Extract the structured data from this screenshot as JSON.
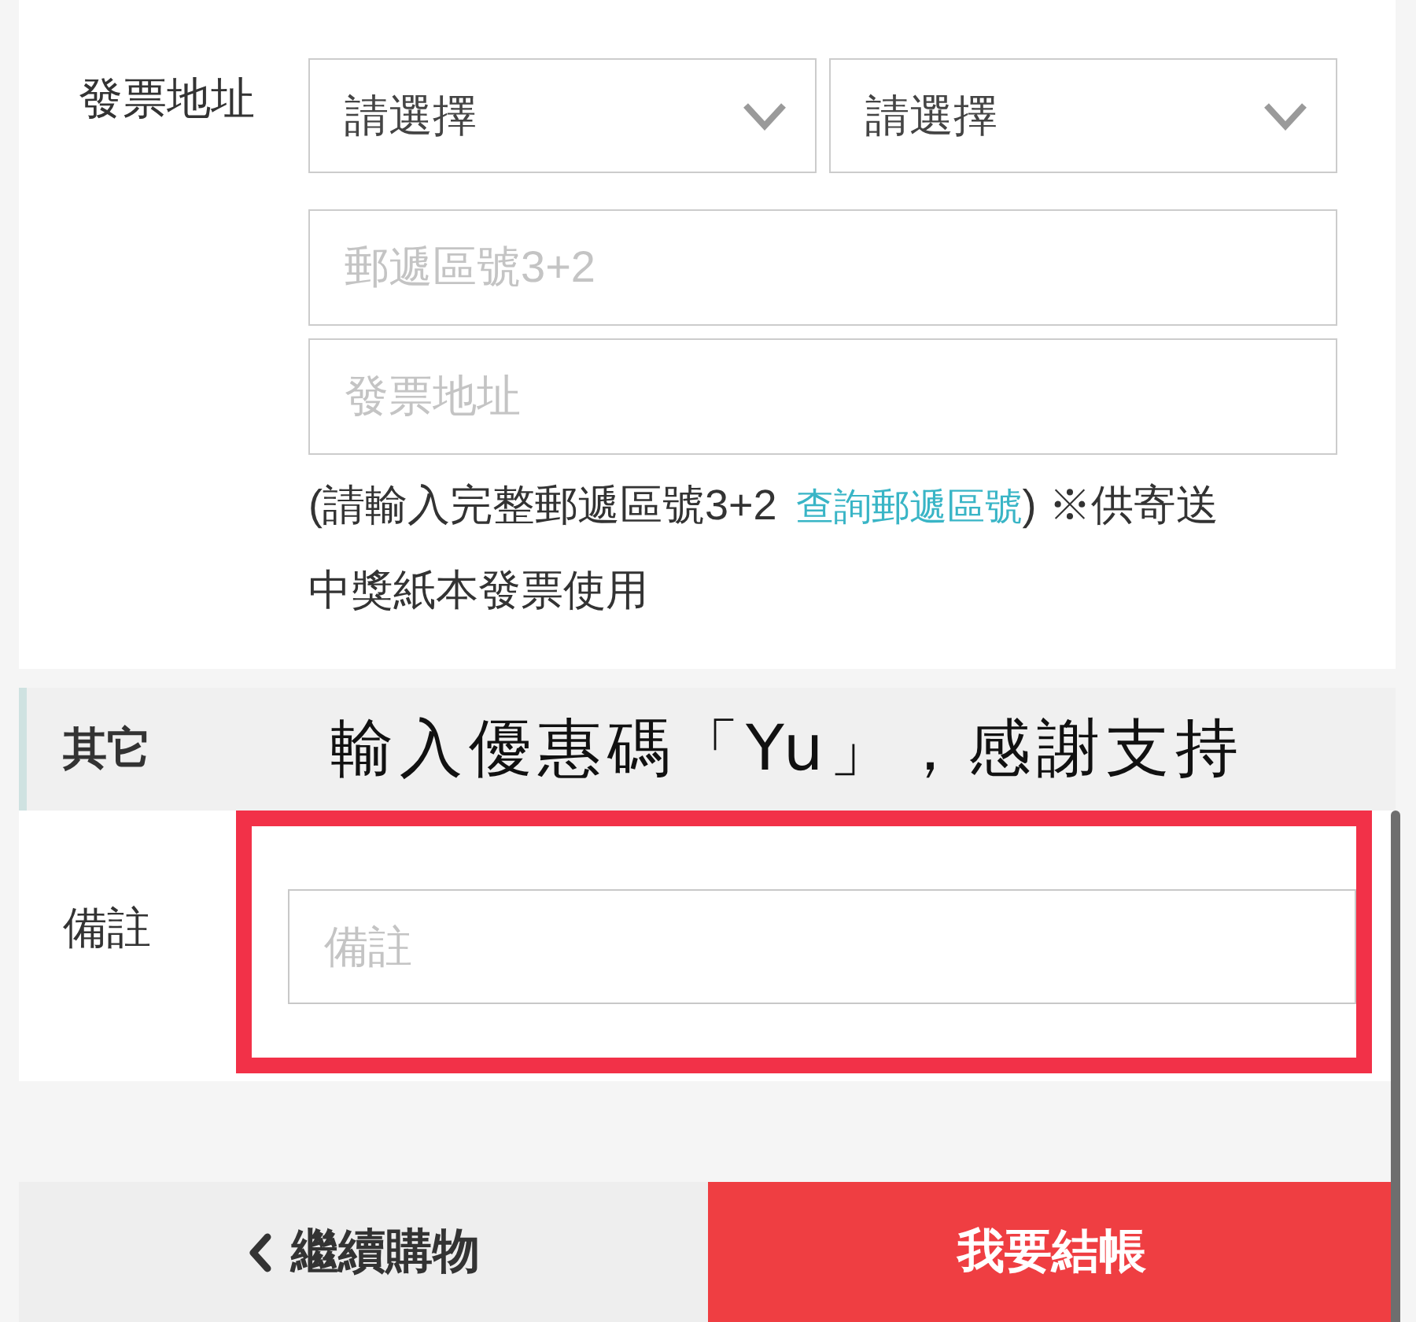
{
  "invoice_address": {
    "label": "發票地址",
    "selects": [
      {
        "value": "請選擇"
      },
      {
        "value": "請選擇"
      }
    ],
    "fields": [
      {
        "placeholder": "郵遞區號3+2"
      },
      {
        "placeholder": "發票地址"
      }
    ],
    "hint": {
      "text_before": "(請輸入完整郵遞區號3+2",
      "link": "查詢郵遞區號",
      "text_after": ") ※供寄送中獎紙本發票使用"
    }
  },
  "other_section": {
    "title": "其它",
    "annotation": "輸入優惠碼「Yu」，感謝支持"
  },
  "remark": {
    "label": "備註",
    "placeholder": "備註"
  },
  "buttons": [
    {
      "kind": "back",
      "label": "繼續購物"
    },
    {
      "kind": "primary",
      "label": "我要結帳"
    }
  ]
}
